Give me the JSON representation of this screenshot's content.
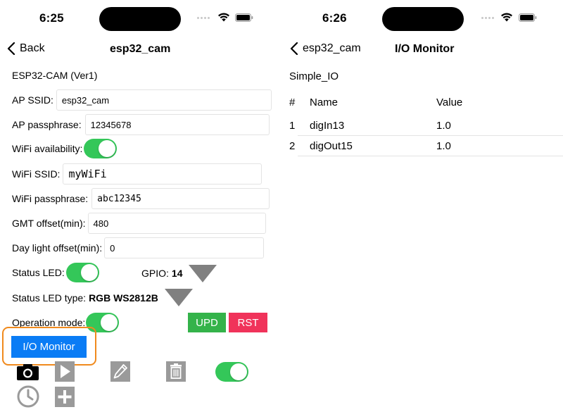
{
  "left": {
    "status": {
      "time": "6:25"
    },
    "nav": {
      "back_label": "Back",
      "title": "esp32_cam"
    },
    "device_title": "ESP32-CAM (Ver1)",
    "ap_ssid": {
      "label": "AP SSID:",
      "value": "esp32_cam"
    },
    "ap_passphrase": {
      "label": "AP passphrase:",
      "value": "12345678"
    },
    "wifi_availability": {
      "label": "WiFi availability:",
      "on": true
    },
    "wifi_ssid": {
      "label": "WiFi SSID:",
      "value": "myWiFi"
    },
    "wifi_passphrase": {
      "label": "WiFi passphrase:",
      "value": "abc12345"
    },
    "gmt_offset": {
      "label": "GMT offset(min):",
      "value": "480"
    },
    "daylight_offset": {
      "label": "Day light offset(min):",
      "value": "0"
    },
    "status_led": {
      "label": "Status LED:",
      "on": true,
      "gpio_label": "GPIO:",
      "gpio_value": "14"
    },
    "status_led_type": {
      "label": "Status LED type:",
      "value": "RGB WS2812B"
    },
    "operation_mode": {
      "label": "Operation mode:",
      "on": true
    },
    "buttons": {
      "upd": "UPD",
      "rst": "RST",
      "io_monitor": "I/O Monitor"
    },
    "toolbar_icons": [
      "camera-icon",
      "play-icon",
      "pencil-icon",
      "trash-icon",
      "toggle",
      "clock-icon",
      "plus-icon"
    ]
  },
  "right": {
    "status": {
      "time": "6:26"
    },
    "nav": {
      "back_label": "esp32_cam",
      "title": "I/O Monitor"
    },
    "section": "Simple_IO",
    "columns": [
      "#",
      "Name",
      "Value"
    ],
    "rows": [
      {
        "index": "1",
        "name": "digIn13",
        "value": "1.0"
      },
      {
        "index": "2",
        "name": "digOut15",
        "value": "1.0"
      }
    ]
  },
  "colors": {
    "toggle_on": "#34c759",
    "upd": "#34b34a",
    "rst": "#f0335a",
    "io_button": "#0a7cf5",
    "highlight": "#f08a1d",
    "icon_gray": "#808080"
  }
}
